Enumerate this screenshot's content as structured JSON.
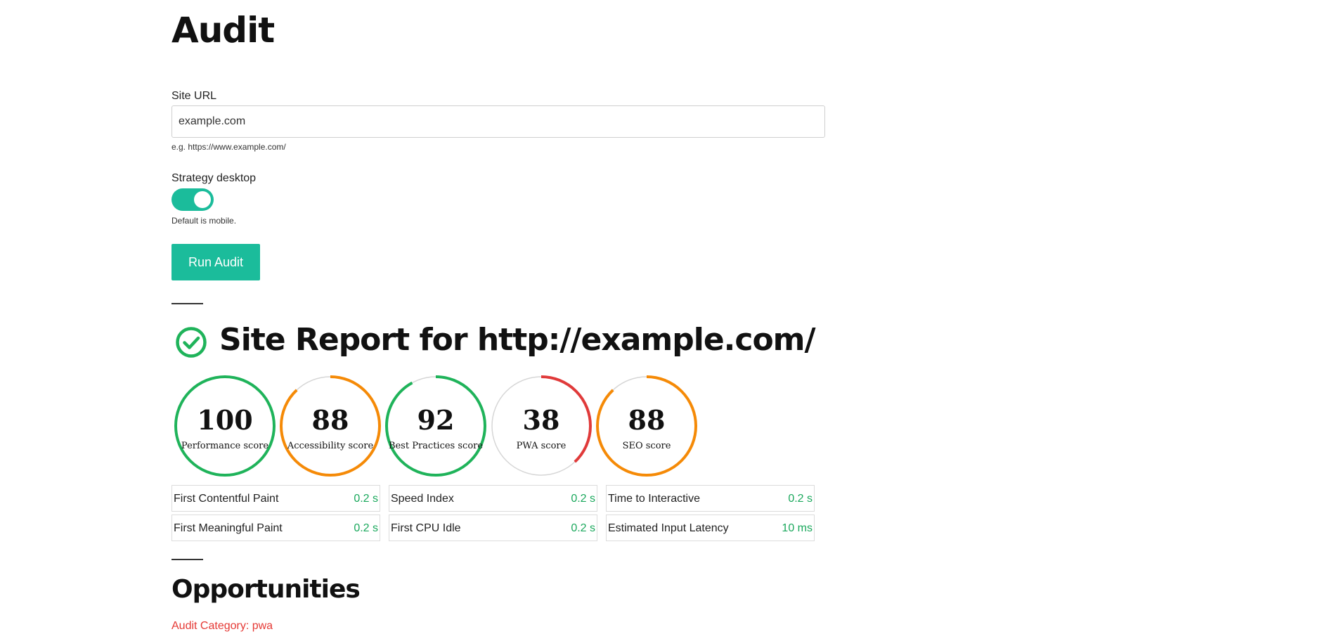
{
  "header": {
    "title": "Audit"
  },
  "form": {
    "site_url_label": "Site URL",
    "site_url_value": "example.com",
    "site_url_help": "e.g. https://www.example.com/",
    "strategy_label": "Strategy desktop",
    "strategy_on": true,
    "strategy_help": "Default is mobile.",
    "run_button": "Run Audit"
  },
  "report": {
    "title": "Site Report for http://example.com/",
    "status_icon": "check-circle-icon",
    "scores": [
      {
        "value": 100,
        "label": "Performance score",
        "color": "#1fb35a"
      },
      {
        "value": 88,
        "label": "Accessibility score",
        "color": "#f58a07"
      },
      {
        "value": 92,
        "label": "Best Practices score",
        "color": "#1fb35a"
      },
      {
        "value": 38,
        "label": "PWA score",
        "color": "#e03a3a"
      },
      {
        "value": 88,
        "label": "SEO score",
        "color": "#f58a07"
      }
    ],
    "metrics": [
      {
        "name": "First Contentful Paint",
        "value": "0.2 s"
      },
      {
        "name": "Speed Index",
        "value": "0.2 s"
      },
      {
        "name": "Time to Interactive",
        "value": "0.2 s"
      },
      {
        "name": "First Meaningful Paint",
        "value": "0.2 s"
      },
      {
        "name": "First CPU Idle",
        "value": "0.2 s"
      },
      {
        "name": "Estimated Input Latency",
        "value": "10 ms"
      }
    ],
    "metric_value_color": "#1aa85c"
  },
  "opportunities": {
    "title": "Opportunities",
    "category": "Audit Category: pwa"
  },
  "colors": {
    "accent": "#1bbc9b",
    "track": "#d6d6d6",
    "error": "#e53935"
  }
}
